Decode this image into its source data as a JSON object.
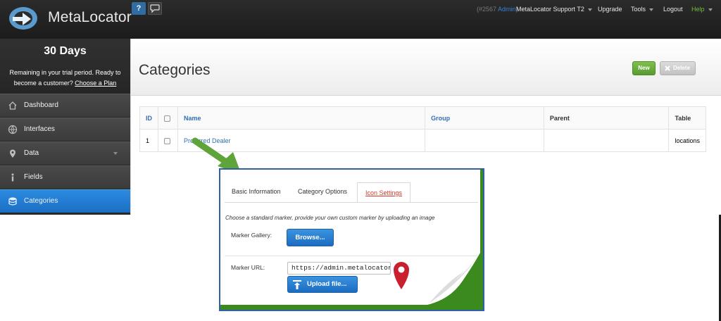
{
  "topbar": {
    "logo_text": "MetaLocator",
    "help_button": "?",
    "account_id": "(#2567",
    "account_role": "Admin)",
    "account_name": "MetaLocator Support T2",
    "upgrade": "Upgrade",
    "tools": "Tools",
    "logout": "Logout",
    "help": "Help",
    "help_color": "#6cbf3c"
  },
  "sidebar": {
    "trial_days": "30 Days",
    "trial_msg": "Remaining in your trial period. Ready to become a customer?",
    "trial_link": "Choose a Plan",
    "items": [
      {
        "label": "Dashboard",
        "icon": "home-icon"
      },
      {
        "label": "Interfaces",
        "icon": "globe-icon"
      },
      {
        "label": "Data",
        "icon": "map-pin-icon"
      },
      {
        "label": "Fields",
        "icon": "info-icon"
      },
      {
        "label": "Categories",
        "icon": "database-icon",
        "active": true
      }
    ]
  },
  "main": {
    "title": "Categories",
    "new_button": "New",
    "delete_button": "Delete",
    "table": {
      "headers": [
        "ID",
        "",
        "Name",
        "Group",
        "Parent",
        "Table"
      ],
      "rows": [
        {
          "id": "1",
          "name": "Preferred Dealer",
          "group": "",
          "parent": "",
          "table": "locations"
        }
      ]
    }
  },
  "callout": {
    "tabs": [
      "Basic Information",
      "Category Options",
      "Icon Settings"
    ],
    "active_tab": "Icon Settings",
    "description": "Choose a standard marker, provide your own custom marker by uploading an image",
    "marker_gallery_label": "Marker Gallery:",
    "browse_button": "Browse...",
    "marker_url_label": "Marker URL:",
    "marker_url_value": "https://admin.metalocator",
    "upload_button": "Upload file...",
    "accent_color": "#d43a2a",
    "border_color": "#3a8a1e"
  }
}
